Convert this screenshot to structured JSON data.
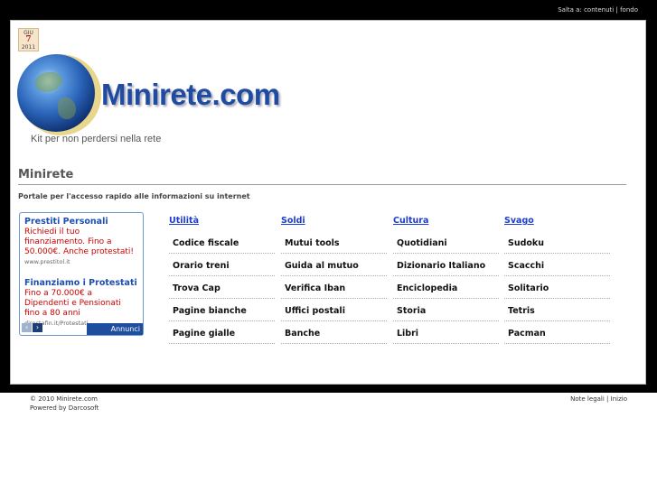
{
  "topbar": {
    "skip_label": "Salta a:",
    "skip_contents": "contenuti",
    "sep": "|",
    "skip_bottom": "fondo"
  },
  "date": {
    "month": "GIU",
    "day": "7",
    "year": "2011"
  },
  "site": {
    "logo": "Minirete.com",
    "tagline": "Kit per non perdersi nella rete"
  },
  "section": {
    "title": "Minirete",
    "description": "Portale per l'accesso rapido alle informazioni su internet"
  },
  "ad": {
    "items": [
      {
        "title": "Prestiti Personali",
        "body": "Richiedi il tuo finanziamento. Fino a 50.000€. Anche protestati!",
        "url": "www.prestitol.it"
      },
      {
        "title": "Finanziamo i Protestati",
        "body": "Fino a 70.000€ a Dipendenti e Pensionati fino a 80 anni",
        "url": "directafin.it/Protestati"
      }
    ],
    "prev": "‹",
    "next": "›",
    "brand": "Annunci Google"
  },
  "columns": [
    {
      "head": "Utilità",
      "items": [
        "Codice fiscale",
        "Orario treni",
        "Trova Cap",
        "Pagine bianche",
        "Pagine gialle"
      ]
    },
    {
      "head": "Soldi",
      "items": [
        "Mutui tools",
        "Guida al mutuo",
        "Verifica Iban",
        "Uffici postali",
        "Banche"
      ]
    },
    {
      "head": "Cultura",
      "items": [
        "Quotidiani",
        "Dizionario Italiano",
        "Enciclopedia",
        "Storia",
        "Libri"
      ]
    },
    {
      "head": "Svago",
      "items": [
        "Sudoku",
        "Scacchi",
        "Solitario",
        "Tetris",
        "Pacman"
      ]
    }
  ],
  "footer": {
    "copyright": "© 2010 Minirete.com",
    "powered": "Powered by Darcosoft",
    "legal": "Note legali",
    "sep": "|",
    "home": "Inizio"
  }
}
